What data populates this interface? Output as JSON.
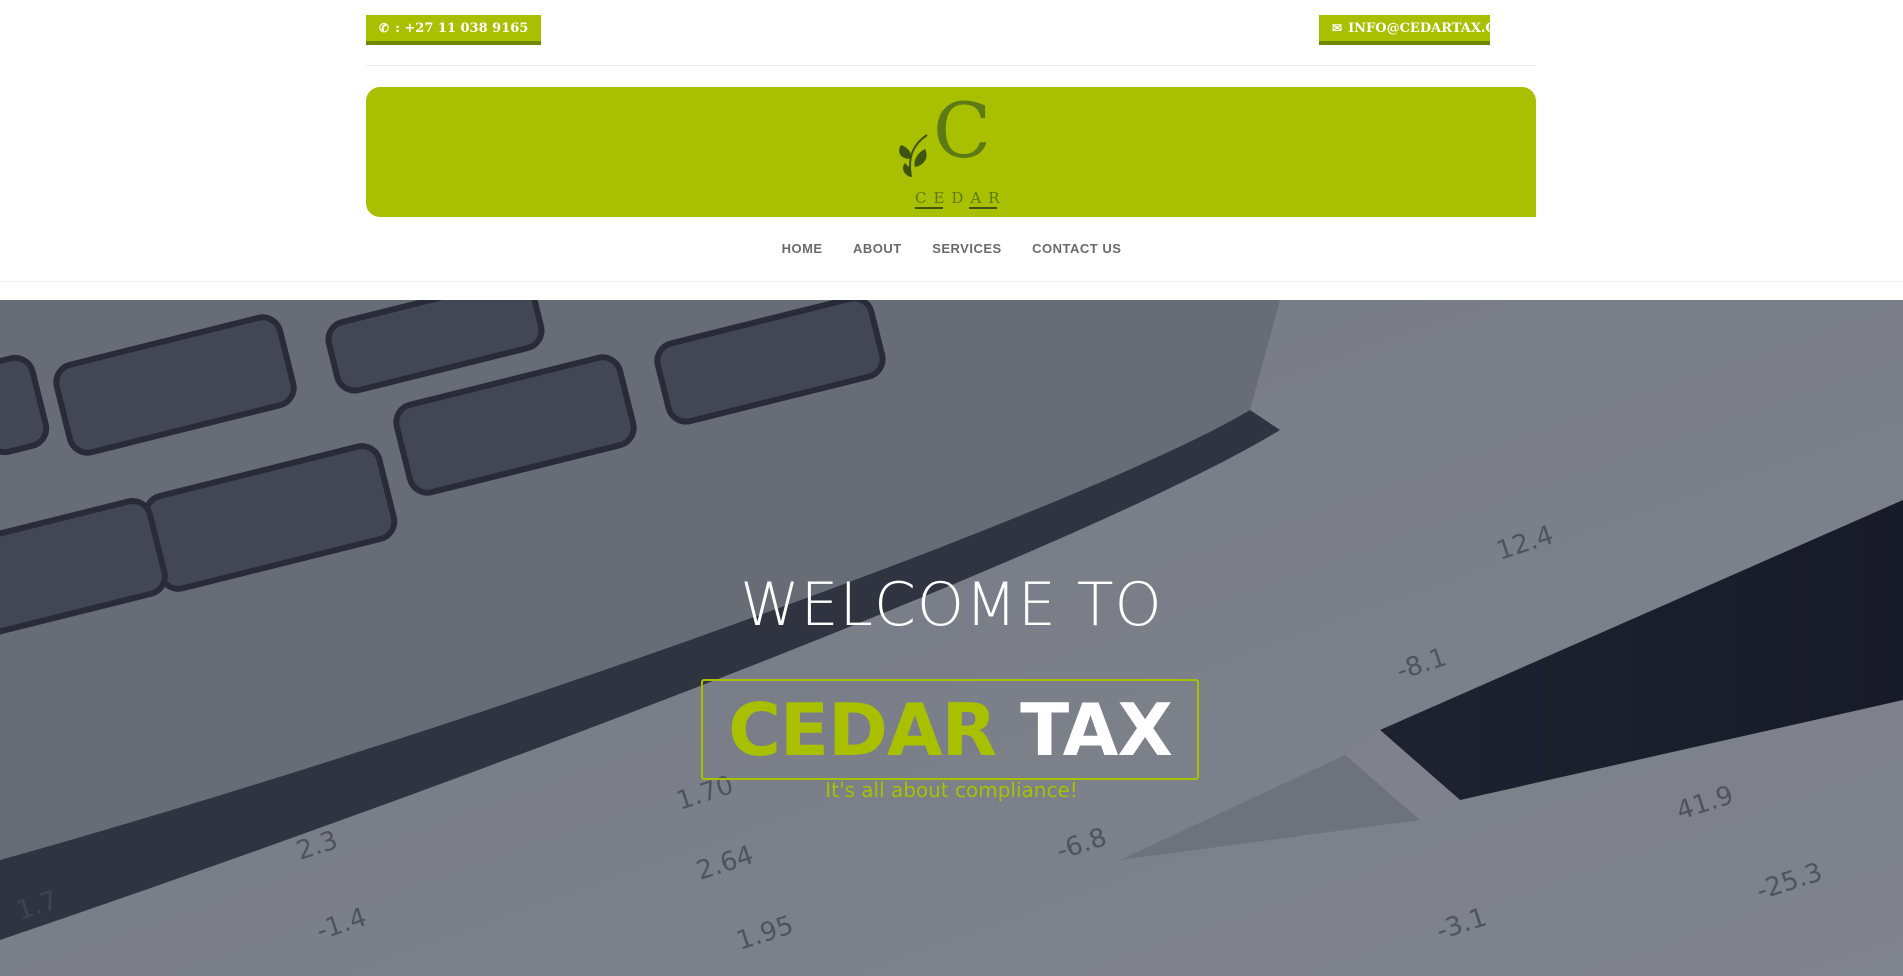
{
  "topbar": {
    "phone": ": +27 11 038 9165",
    "phone_icon": "phone-icon",
    "email": "INFO@CEDARTAX.CO.ZA",
    "email_icon": "envelope-icon"
  },
  "logo": {
    "letter": "C",
    "word": "CEDAR"
  },
  "nav": {
    "items": [
      "HOME",
      "ABOUT",
      "SERVICES",
      "CONTACT US"
    ]
  },
  "hero": {
    "welcome": "WELCOME TO",
    "brand_part1": "CEDAR",
    "brand_part2": "TAX",
    "tagline": "It's all about compliance!"
  },
  "colors": {
    "accent": "#a8c000",
    "accent_dark": "#6f8a00",
    "logo_green": "#5e7a14",
    "nav_text": "#6a6a6a"
  }
}
